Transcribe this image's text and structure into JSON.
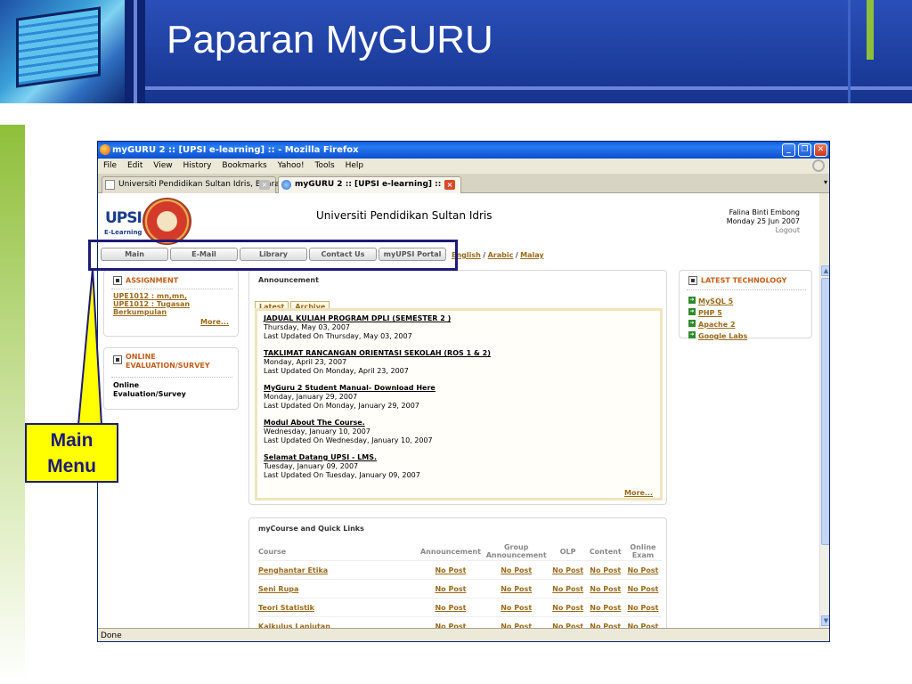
{
  "slide": {
    "title": "Paparan MyGURU",
    "callout": {
      "line1": "Main",
      "line2": "Menu"
    },
    "colors": {
      "header": "#1c3a94",
      "accent_green": "#8fbf3a",
      "callout_fill": "#ffff00",
      "callout_border": "#1e1a78"
    }
  },
  "browser": {
    "window_title": "myGURU 2 :: [UPSI e-learning] :: - Mozilla Firefox",
    "window_buttons": {
      "minimize": "_",
      "maximize": "❐",
      "close": "✕"
    },
    "menu": [
      "File",
      "Edit",
      "View",
      "History",
      "Bookmarks",
      "Yahoo!",
      "Tools",
      "Help"
    ],
    "tabs": [
      {
        "label": "Universiti Pendidikan Sultan Idris, Bitara",
        "close": "×"
      },
      {
        "label": "myGURU 2 :: [UPSI e-learning] ::",
        "close": "×"
      }
    ],
    "tab_list_arrow": "▾",
    "scroll_up": "▲",
    "scroll_down": "▼",
    "status": "Done"
  },
  "site": {
    "logo_text": "UPSI",
    "logo_sub": "E-Learning",
    "university": "Universiti Pendidikan Sultan Idris",
    "user_name": "Falina Binti Embong",
    "date": "Monday 25 Jun 2007",
    "logout": "Logout",
    "nav": [
      "Main",
      "E-Mail",
      "Library",
      "Contact Us",
      "myUPSI Portal"
    ],
    "lang": {
      "english": "English",
      "sep1": " / ",
      "arabic": "Arabic",
      "sep2": " / ",
      "malay": "Malay"
    }
  },
  "assignment": {
    "title": "ASSIGNMENT",
    "items": [
      "UPE1012 : mn,mn,",
      "UPE1012 : Tugasan",
      "Berkumpulan"
    ],
    "more": "More..."
  },
  "evaluation": {
    "title_line1": "ONLINE",
    "title_line2": "EVALUATION/SURVEY",
    "text_line1": "Online",
    "text_line2": "Evaluation/Survey"
  },
  "announcement": {
    "title": "Announcement",
    "tabs": [
      "Latest",
      "Archive"
    ],
    "items": [
      {
        "title": "JADUAL KULIAH PROGRAM DPLI (SEMESTER 2 )",
        "date": "Thursday, May 03, 2007",
        "updated": "Last Updated On Thursday, May 03, 2007"
      },
      {
        "title": "TAKLIMAT RANCANGAN ORIENTASI SEKOLAH (ROS 1 & 2)",
        "date": "Monday, April 23, 2007",
        "updated": "Last Updated On Monday, April 23, 2007"
      },
      {
        "title": "MyGuru 2 Student Manual- Download Here",
        "date": "Monday, January 29, 2007",
        "updated": "Last Updated On Monday, January 29, 2007"
      },
      {
        "title": "Modul About The Course.",
        "date": "Wednesday, January 10, 2007",
        "updated": "Last Updated On Wednesday, January 10, 2007"
      },
      {
        "title": "Selamat Datang UPSI - LMS.",
        "date": "Tuesday, January 09, 2007",
        "updated": "Last Updated On Tuesday, January 09, 2007"
      }
    ],
    "more": "More..."
  },
  "technology": {
    "title": "LATEST TECHNOLOGY",
    "items": [
      "MySQL 5",
      "PHP 5",
      "Apache 2",
      "Google Labs"
    ]
  },
  "courses": {
    "title": "myCourse and Quick Links",
    "headers": [
      "Course",
      "Announcement",
      "Group Announcement",
      "OLP",
      "Content",
      "Online Exam"
    ],
    "rows": [
      [
        "Penghantar Etika",
        "No Post",
        "No Post",
        "No Post",
        "No Post",
        "No Post"
      ],
      [
        "Seni Rupa",
        "No Post",
        "No Post",
        "No Post",
        "No Post",
        "No Post"
      ],
      [
        "Teori Statistik",
        "No Post",
        "No Post",
        "No Post",
        "No Post",
        "No Post"
      ],
      [
        "Kalkulus Lanjutan",
        "No Post",
        "No Post",
        "No Post",
        "No Post",
        "No Post"
      ]
    ]
  }
}
